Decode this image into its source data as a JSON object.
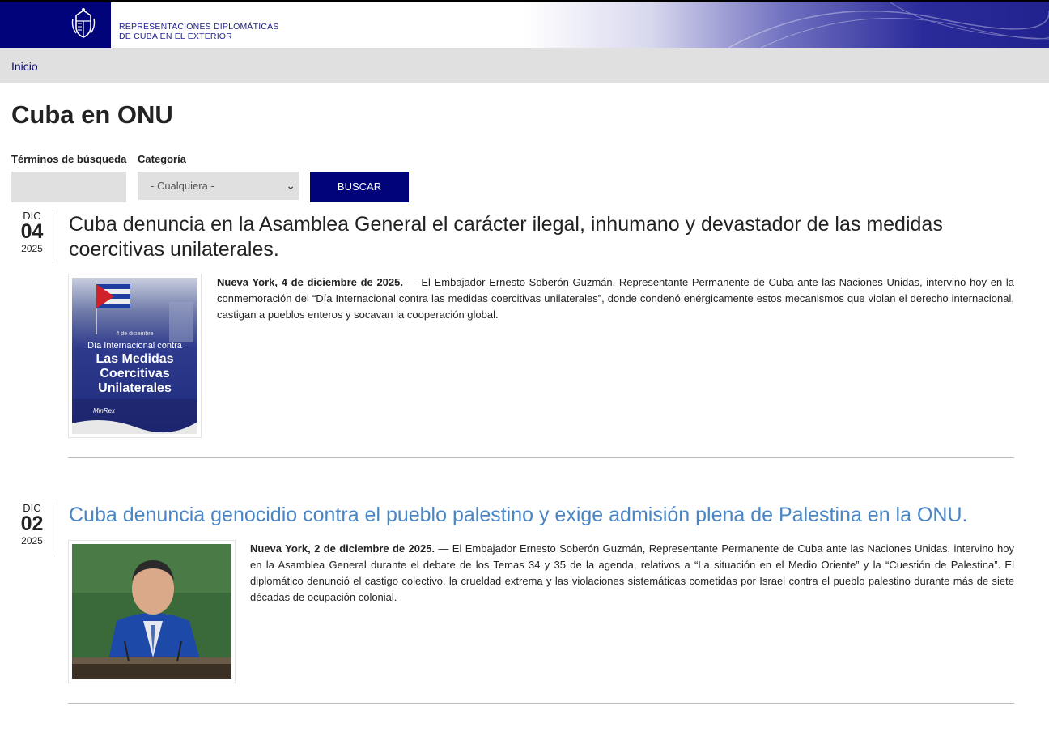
{
  "header": {
    "site_title_line1": "REPRESENTACIONES DIPLOMÁTICAS",
    "site_title_line2": "DE CUBA EN EL EXTERIOR",
    "logo_icon": "cuban-coat-of-arms"
  },
  "breadcrumb": {
    "home": "Inicio"
  },
  "page": {
    "title": "Cuba en ONU"
  },
  "filters": {
    "terms_label": "Términos de búsqueda",
    "terms_value": "",
    "category_label": "Categoría",
    "category_value": "- Cualquiera -",
    "submit_label": "BUSCAR"
  },
  "articles": [
    {
      "month": "DIC",
      "day": "04",
      "year": "2025",
      "title": "Cuba denuncia en la Asamblea General el carácter ilegal, inhumano y devastador de las medidas coercitivas unilaterales.",
      "lead": "Nueva York, 4 de diciembre de 2025.",
      "body": " — El Embajador Ernesto Soberón Guzmán, Representante Permanente de Cuba ante las Naciones Unidas, intervino hoy en la conmemoración del “Día Internacional contra las medidas coercitivas unilaterales”, donde condenó enérgicamente estos mecanismos que violan el derecho internacional, castigan a pueblos enteros y socavan la cooperación global.",
      "image": {
        "small": "4 de diciembre",
        "line1": "Día Internacional contra",
        "line2": "Las Medidas",
        "line3": "Coercitivas",
        "line4": "Unilaterales",
        "sign": "MinRex"
      }
    },
    {
      "month": "DIC",
      "day": "02",
      "year": "2025",
      "title": "Cuba denuncia genocidio contra el pueblo palestino y exige admisión plena de Palestina en la ONU.",
      "lead": "Nueva York, 2 de diciembre de 2025.",
      "body": " — El Embajador Ernesto Soberón Guzmán, Representante Permanente de Cuba ante las Naciones Unidas, intervino hoy en la Asamblea General durante el debate de los Temas 34 y 35 de la agenda, relativos a “La situación en el Medio Oriente” y la “Cuestión de Palestina”. El diplomático denunció el castigo colectivo, la crueldad extrema y las violaciones sistemáticas cometidas por Israel contra el pueblo palestino durante más de siete décadas de ocupación colonial."
    }
  ]
}
